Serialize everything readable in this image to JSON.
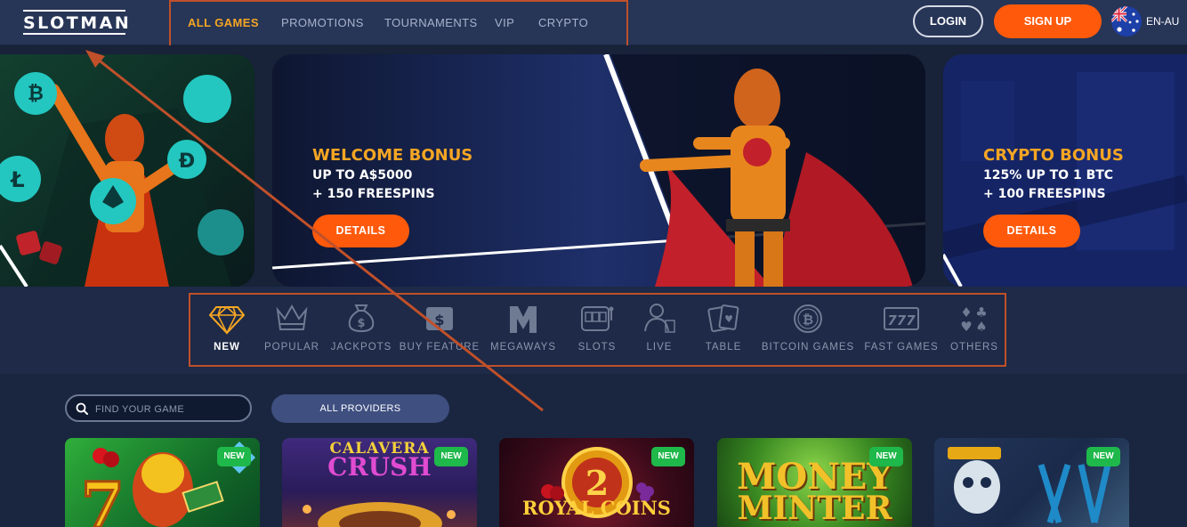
{
  "header": {
    "logo": "SLOTMAN",
    "nav": [
      {
        "label": "ALL GAMES",
        "active": true
      },
      {
        "label": "PROMOTIONS",
        "active": false
      },
      {
        "label": "TOURNAMENTS",
        "active": false
      },
      {
        "label": "VIP",
        "active": false
      },
      {
        "label": "CRYPTO",
        "active": false
      }
    ],
    "login_label": "LOGIN",
    "signup_label": "SIGN UP",
    "language": "EN-AU"
  },
  "hero": {
    "welcome": {
      "title": "WELCOME BONUS",
      "line1": "UP TO A$5000",
      "line2": "+ 150 FREESPINS",
      "button": "DETAILS"
    },
    "crypto": {
      "title": "CRYPTO BONUS",
      "line1": "125% UP TO 1 BTC",
      "line2": "+ 100 FREESPINS",
      "button": "DETAILS"
    },
    "slide_count": 6,
    "active_slide": 1
  },
  "categories": [
    {
      "label": "NEW",
      "icon": "diamond-icon",
      "active": true
    },
    {
      "label": "POPULAR",
      "icon": "crown-icon",
      "active": false
    },
    {
      "label": "JACKPOTS",
      "icon": "money-bag-icon",
      "active": false
    },
    {
      "label": "BUY FEATURE",
      "icon": "dollar-bill-icon",
      "active": false
    },
    {
      "label": "MEGAWAYS",
      "icon": "megaways-m-icon",
      "active": false
    },
    {
      "label": "SLOTS",
      "icon": "slot-machine-icon",
      "active": false
    },
    {
      "label": "LIVE",
      "icon": "live-dealer-icon",
      "active": false
    },
    {
      "label": "TABLE",
      "icon": "playing-cards-icon",
      "active": false
    },
    {
      "label": "BITCOIN GAMES",
      "icon": "bitcoin-icon",
      "active": false
    },
    {
      "label": "FAST GAMES",
      "icon": "triple-seven-icon",
      "active": false
    },
    {
      "label": "OTHERS",
      "icon": "card-suits-icon",
      "active": false
    }
  ],
  "search": {
    "placeholder": "FIND YOUR GAME"
  },
  "providers_label": "ALL PROVIDERS",
  "games": [
    {
      "badge": "NEW",
      "title": ""
    },
    {
      "badge": "NEW",
      "title": "Calavera Crush"
    },
    {
      "badge": "NEW",
      "title": "Royal Coins"
    },
    {
      "badge": "NEW",
      "title": "Money Minter"
    },
    {
      "badge": "NEW",
      "title": ""
    }
  ],
  "colors": {
    "accent": "#ff5a0b",
    "gold": "#f5a623",
    "annotation": "#c0502a",
    "badge": "#1fb84a"
  }
}
